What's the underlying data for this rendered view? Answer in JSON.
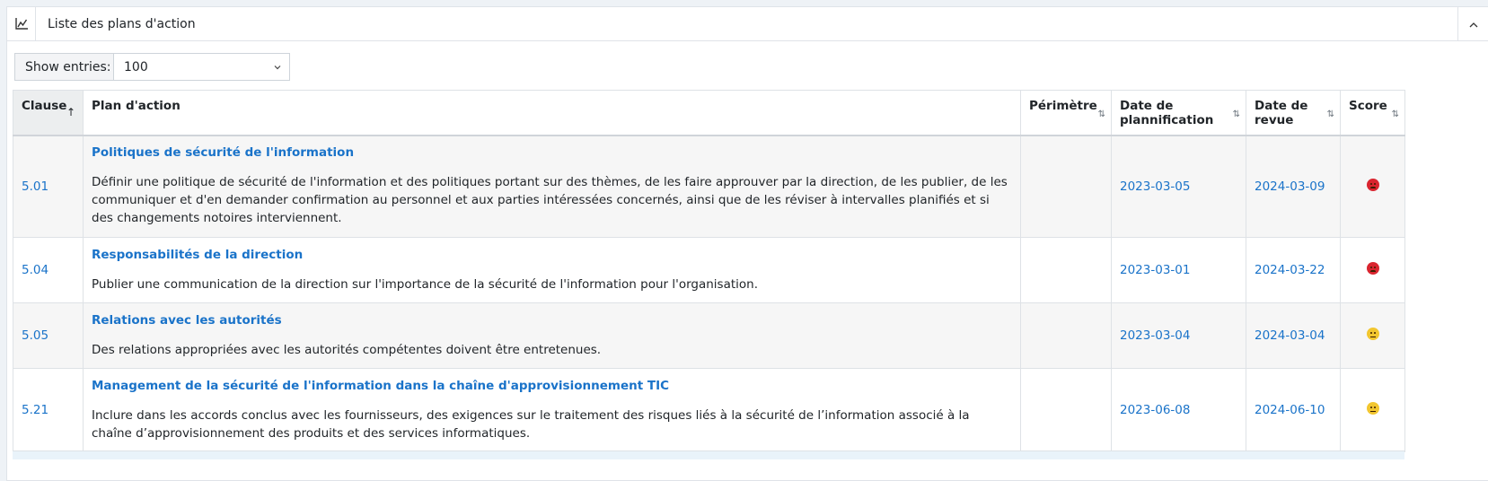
{
  "panel": {
    "title": "Liste des plans d'action",
    "icon": "line-chart-icon",
    "collapse_icon": "chevron-up-icon"
  },
  "entries": {
    "label": "Show entries:",
    "value": "100"
  },
  "table": {
    "columns": {
      "clause": "Clause",
      "plan": "Plan d'action",
      "perimetre": "Périmètre",
      "date_plan_1": "Date de",
      "date_plan_2": "plannification",
      "date_revue_1": "Date de",
      "date_revue_2": "revue",
      "score": "Score"
    },
    "rows": [
      {
        "clause": "5.01",
        "title": "Politiques de sécurité de l'information",
        "description": "Définir une politique de sécurité de l'information et des politiques portant sur des thèmes, de les faire approuver par la direction, de les publier, de les communiquer et d'en demander confirmation au personnel et aux parties intéressées concernés, ainsi que de les réviser à intervalles planifiés et si des changements notoires interviennent.",
        "perimetre": "",
        "date_plan": "2023-03-05",
        "date_revue": "2024-03-09",
        "score": "angry"
      },
      {
        "clause": "5.04",
        "title": "Responsabilités de la direction",
        "description": "Publier une communication de la direction sur l'importance de la sécurité de l'information pour l'organisation.",
        "perimetre": "",
        "date_plan": "2023-03-01",
        "date_revue": "2024-03-22",
        "score": "angry"
      },
      {
        "clause": "5.05",
        "title": "Relations avec les autorités",
        "description": "Des relations appropriées avec les autorités compétentes doivent être entretenues.",
        "perimetre": "",
        "date_plan": "2023-03-04",
        "date_revue": "2024-03-04",
        "score": "neutral"
      },
      {
        "clause": "5.21",
        "title": "Management de la sécurité de l'information dans la chaîne d'approvisionnement TIC",
        "description": "Inclure dans les accords conclus avec les fournisseurs, des exigences sur le traitement des risques liés à la sécurité de l’information associé à la chaîne d’approvisionnement des produits et des services informatiques.",
        "perimetre": "",
        "date_plan": "2023-06-08",
        "date_revue": "2024-06-10",
        "score": "neutral"
      }
    ]
  },
  "colors": {
    "link": "#1a73c9",
    "score_bad": "#d9252f",
    "score_medium": "#f2c62f"
  }
}
